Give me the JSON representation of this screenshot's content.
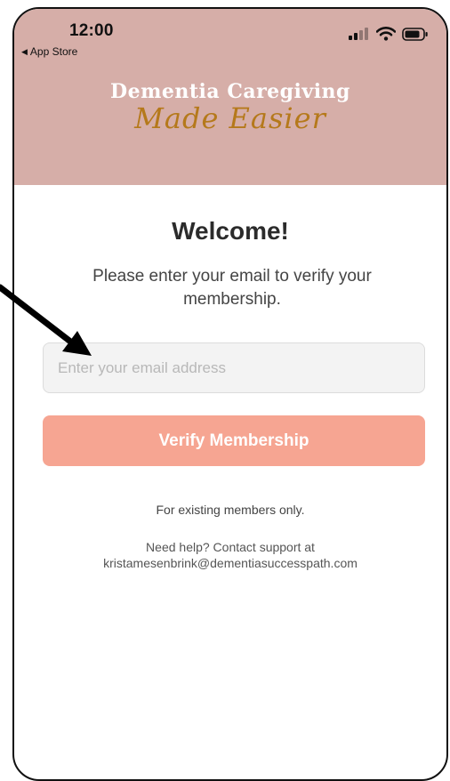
{
  "status_bar": {
    "time": "12:00",
    "back_label": "App Store"
  },
  "header": {
    "title": "Dementia Caregiving",
    "subtitle": "Made Easier",
    "background_color": "#d6aea8",
    "subtitle_color": "#b5791b"
  },
  "main": {
    "heading": "Welcome!",
    "instruction": "Please enter your email to verify your membership.",
    "email_input": {
      "placeholder": "Enter your email address",
      "value": ""
    },
    "verify_button_label": "Verify Membership",
    "button_color": "#f6a592",
    "existing_note": "For existing members only.",
    "help_line": "Need help? Contact support at",
    "support_email": "kristamesenbrink@dementiasuccesspath.com"
  },
  "icons": {
    "back": "back-triangle-icon",
    "signal": "cellular-signal-icon",
    "wifi": "wifi-icon",
    "battery": "battery-icon",
    "annotation": "annotation-arrow-icon"
  }
}
